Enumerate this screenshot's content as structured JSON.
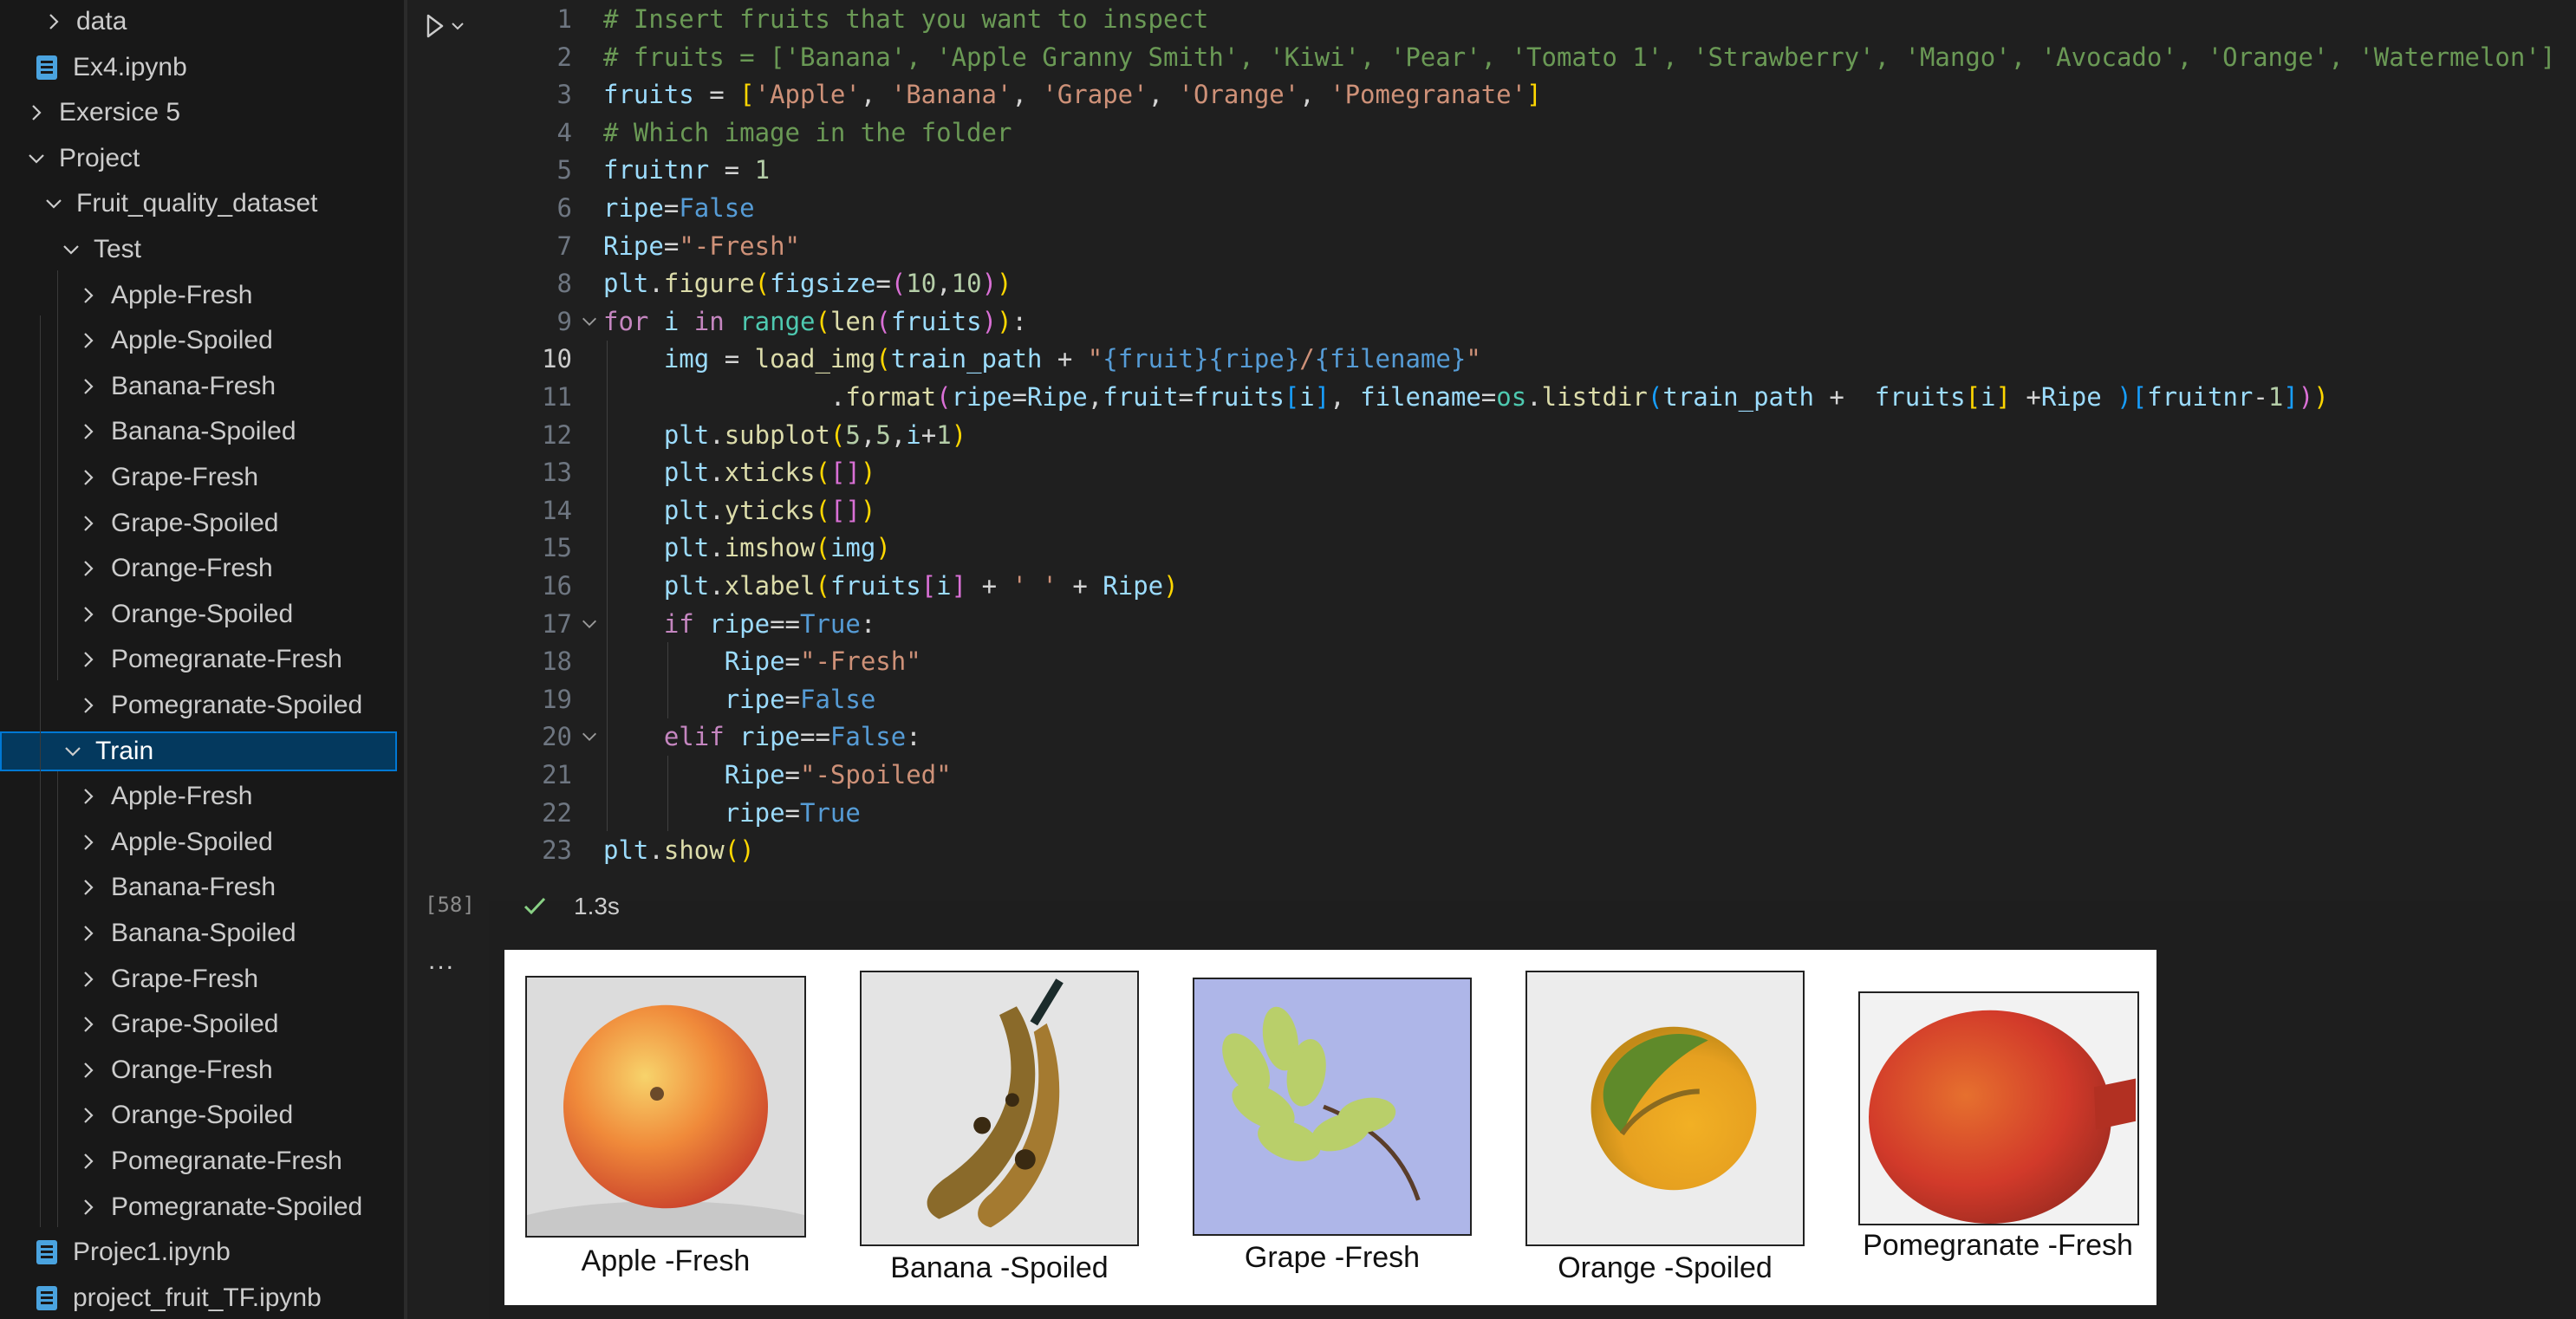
{
  "explorer": {
    "items": [
      {
        "label": "data",
        "depth": 1,
        "kind": "folder",
        "expanded": false
      },
      {
        "label": "Ex4.ipynb",
        "depth": 1,
        "kind": "notebook"
      },
      {
        "label": "Exersice 5",
        "depth": 0,
        "kind": "folder",
        "expanded": false
      },
      {
        "label": "Project",
        "depth": 0,
        "kind": "folder",
        "expanded": true
      },
      {
        "label": "Fruit_quality_dataset",
        "depth": 1,
        "kind": "folder",
        "expanded": true
      },
      {
        "label": "Test",
        "depth": 2,
        "kind": "folder",
        "expanded": true
      },
      {
        "label": "Apple-Fresh",
        "depth": 3,
        "kind": "folder",
        "expanded": false
      },
      {
        "label": "Apple-Spoiled",
        "depth": 3,
        "kind": "folder",
        "expanded": false
      },
      {
        "label": "Banana-Fresh",
        "depth": 3,
        "kind": "folder",
        "expanded": false
      },
      {
        "label": "Banana-Spoiled",
        "depth": 3,
        "kind": "folder",
        "expanded": false
      },
      {
        "label": "Grape-Fresh",
        "depth": 3,
        "kind": "folder",
        "expanded": false
      },
      {
        "label": "Grape-Spoiled",
        "depth": 3,
        "kind": "folder",
        "expanded": false
      },
      {
        "label": "Orange-Fresh",
        "depth": 3,
        "kind": "folder",
        "expanded": false
      },
      {
        "label": "Orange-Spoiled",
        "depth": 3,
        "kind": "folder",
        "expanded": false
      },
      {
        "label": "Pomegranate-Fresh",
        "depth": 3,
        "kind": "folder",
        "expanded": false
      },
      {
        "label": "Pomegranate-Spoiled",
        "depth": 3,
        "kind": "folder",
        "expanded": false
      },
      {
        "label": "Train",
        "depth": 2,
        "kind": "folder",
        "expanded": true,
        "selected": true
      },
      {
        "label": "Apple-Fresh",
        "depth": 3,
        "kind": "folder",
        "expanded": false
      },
      {
        "label": "Apple-Spoiled",
        "depth": 3,
        "kind": "folder",
        "expanded": false
      },
      {
        "label": "Banana-Fresh",
        "depth": 3,
        "kind": "folder",
        "expanded": false
      },
      {
        "label": "Banana-Spoiled",
        "depth": 3,
        "kind": "folder",
        "expanded": false
      },
      {
        "label": "Grape-Fresh",
        "depth": 3,
        "kind": "folder",
        "expanded": false
      },
      {
        "label": "Grape-Spoiled",
        "depth": 3,
        "kind": "folder",
        "expanded": false
      },
      {
        "label": "Orange-Fresh",
        "depth": 3,
        "kind": "folder",
        "expanded": false
      },
      {
        "label": "Orange-Spoiled",
        "depth": 3,
        "kind": "folder",
        "expanded": false
      },
      {
        "label": "Pomegranate-Fresh",
        "depth": 3,
        "kind": "folder",
        "expanded": false
      },
      {
        "label": "Pomegranate-Spoiled",
        "depth": 3,
        "kind": "folder",
        "expanded": false
      },
      {
        "label": "Projec1.ipynb",
        "depth": 1,
        "kind": "notebook"
      },
      {
        "label": "project_fruit_TF.ipynb",
        "depth": 1,
        "kind": "notebook"
      }
    ]
  },
  "cell": {
    "execution_count": "[58]",
    "status_time": "1.3s",
    "output_indicator": "...",
    "active_line": 10,
    "fold_lines": [
      9,
      17,
      20
    ],
    "lines": [
      [
        [
          "c-com",
          "# Insert fruits that you want to inspect"
        ]
      ],
      [
        [
          "c-com",
          "# fruits = ['Banana', 'Apple Granny Smith', 'Kiwi', 'Pear', 'Tomato 1', 'Strawberry', 'Mango', 'Avocado', 'Orange', 'Watermelon']"
        ]
      ],
      [
        [
          "c-var",
          "fruits"
        ],
        [
          "c-op",
          " = "
        ],
        [
          "c-b1",
          "["
        ],
        [
          "c-str",
          "'Apple'"
        ],
        [
          "c-op",
          ", "
        ],
        [
          "c-str",
          "'Banana'"
        ],
        [
          "c-op",
          ", "
        ],
        [
          "c-str",
          "'Grape'"
        ],
        [
          "c-op",
          ", "
        ],
        [
          "c-str",
          "'Orange'"
        ],
        [
          "c-op",
          ", "
        ],
        [
          "c-str",
          "'Pomegranate'"
        ],
        [
          "c-b1",
          "]"
        ]
      ],
      [
        [
          "c-com",
          "# Which image in the folder"
        ]
      ],
      [
        [
          "c-var",
          "fruitnr"
        ],
        [
          "c-op",
          " = "
        ],
        [
          "c-num",
          "1"
        ]
      ],
      [
        [
          "c-var",
          "ripe"
        ],
        [
          "c-op",
          "="
        ],
        [
          "c-const",
          "False"
        ]
      ],
      [
        [
          "c-var",
          "Ripe"
        ],
        [
          "c-op",
          "="
        ],
        [
          "c-str",
          "\"-Fresh\""
        ]
      ],
      [
        [
          "c-var",
          "plt"
        ],
        [
          "c-op",
          "."
        ],
        [
          "c-fn",
          "figure"
        ],
        [
          "c-b1",
          "("
        ],
        [
          "c-var",
          "figsize"
        ],
        [
          "c-op",
          "="
        ],
        [
          "c-b2",
          "("
        ],
        [
          "c-num",
          "10"
        ],
        [
          "c-op",
          ","
        ],
        [
          "c-num",
          "10"
        ],
        [
          "c-b2",
          ")"
        ],
        [
          "c-b1",
          ")"
        ]
      ],
      [
        [
          "c-kw",
          "for"
        ],
        [
          "c-op",
          " "
        ],
        [
          "c-var",
          "i"
        ],
        [
          "c-op",
          " "
        ],
        [
          "c-kw",
          "in"
        ],
        [
          "c-op",
          " "
        ],
        [
          "c-cls",
          "range"
        ],
        [
          "c-b1",
          "("
        ],
        [
          "c-fn",
          "len"
        ],
        [
          "c-b2",
          "("
        ],
        [
          "c-var",
          "fruits"
        ],
        [
          "c-b2",
          ")"
        ],
        [
          "c-b1",
          ")"
        ],
        [
          "c-op",
          ":"
        ]
      ],
      [
        [
          "c-op",
          "    "
        ],
        [
          "c-var",
          "img"
        ],
        [
          "c-op",
          " = "
        ],
        [
          "c-fn",
          "load_img"
        ],
        [
          "c-b1",
          "("
        ],
        [
          "c-var",
          "train_path"
        ],
        [
          "c-op",
          " + "
        ],
        [
          "c-str",
          "\""
        ],
        [
          "c-const",
          "{fruit}{ripe}"
        ],
        [
          "c-str",
          "/"
        ],
        [
          "c-const",
          "{filename}"
        ],
        [
          "c-str",
          "\""
        ]
      ],
      [
        [
          "c-op",
          "               "
        ],
        [
          "c-op",
          "."
        ],
        [
          "c-fn",
          "format"
        ],
        [
          "c-b2",
          "("
        ],
        [
          "c-var",
          "ripe"
        ],
        [
          "c-op",
          "="
        ],
        [
          "c-var",
          "Ripe"
        ],
        [
          "c-op",
          ","
        ],
        [
          "c-var",
          "fruit"
        ],
        [
          "c-op",
          "="
        ],
        [
          "c-var",
          "fruits"
        ],
        [
          "c-b3",
          "["
        ],
        [
          "c-var",
          "i"
        ],
        [
          "c-b3",
          "]"
        ],
        [
          "c-op",
          ", "
        ],
        [
          "c-var",
          "filename"
        ],
        [
          "c-op",
          "="
        ],
        [
          "c-cls",
          "os"
        ],
        [
          "c-op",
          "."
        ],
        [
          "c-fn",
          "listdir"
        ],
        [
          "c-b3",
          "("
        ],
        [
          "c-var",
          "train_path"
        ],
        [
          "c-op",
          " +  "
        ],
        [
          "c-var",
          "fruits"
        ],
        [
          "c-b1",
          "["
        ],
        [
          "c-var",
          "i"
        ],
        [
          "c-b1",
          "]"
        ],
        [
          "c-op",
          " +"
        ],
        [
          "c-var",
          "Ripe"
        ],
        [
          "c-op",
          " "
        ],
        [
          "c-b3",
          ")"
        ],
        [
          "c-b3",
          "["
        ],
        [
          "c-var",
          "fruitnr"
        ],
        [
          "c-op",
          "-"
        ],
        [
          "c-num",
          "1"
        ],
        [
          "c-b3",
          "]"
        ],
        [
          "c-b2",
          ")"
        ],
        [
          "c-b1",
          ")"
        ]
      ],
      [
        [
          "c-op",
          "    "
        ],
        [
          "c-var",
          "plt"
        ],
        [
          "c-op",
          "."
        ],
        [
          "c-fn",
          "subplot"
        ],
        [
          "c-b1",
          "("
        ],
        [
          "c-num",
          "5"
        ],
        [
          "c-op",
          ","
        ],
        [
          "c-num",
          "5"
        ],
        [
          "c-op",
          ","
        ],
        [
          "c-var",
          "i"
        ],
        [
          "c-op",
          "+"
        ],
        [
          "c-num",
          "1"
        ],
        [
          "c-b1",
          ")"
        ]
      ],
      [
        [
          "c-op",
          "    "
        ],
        [
          "c-var",
          "plt"
        ],
        [
          "c-op",
          "."
        ],
        [
          "c-fn",
          "xticks"
        ],
        [
          "c-b1",
          "("
        ],
        [
          "c-b2",
          "[]"
        ],
        [
          "c-b1",
          ")"
        ]
      ],
      [
        [
          "c-op",
          "    "
        ],
        [
          "c-var",
          "plt"
        ],
        [
          "c-op",
          "."
        ],
        [
          "c-fn",
          "yticks"
        ],
        [
          "c-b1",
          "("
        ],
        [
          "c-b2",
          "[]"
        ],
        [
          "c-b1",
          ")"
        ]
      ],
      [
        [
          "c-op",
          "    "
        ],
        [
          "c-var",
          "plt"
        ],
        [
          "c-op",
          "."
        ],
        [
          "c-fn",
          "imshow"
        ],
        [
          "c-b1",
          "("
        ],
        [
          "c-var",
          "img"
        ],
        [
          "c-b1",
          ")"
        ]
      ],
      [
        [
          "c-op",
          "    "
        ],
        [
          "c-var",
          "plt"
        ],
        [
          "c-op",
          "."
        ],
        [
          "c-fn",
          "xlabel"
        ],
        [
          "c-b1",
          "("
        ],
        [
          "c-var",
          "fruits"
        ],
        [
          "c-b2",
          "["
        ],
        [
          "c-var",
          "i"
        ],
        [
          "c-b2",
          "]"
        ],
        [
          "c-op",
          " + "
        ],
        [
          "c-str",
          "' '"
        ],
        [
          "c-op",
          " + "
        ],
        [
          "c-var",
          "Ripe"
        ],
        [
          "c-b1",
          ")"
        ]
      ],
      [
        [
          "c-op",
          "    "
        ],
        [
          "c-kw",
          "if"
        ],
        [
          "c-op",
          " "
        ],
        [
          "c-var",
          "ripe"
        ],
        [
          "c-op",
          "=="
        ],
        [
          "c-const",
          "True"
        ],
        [
          "c-op",
          ":"
        ]
      ],
      [
        [
          "c-op",
          "        "
        ],
        [
          "c-var",
          "Ripe"
        ],
        [
          "c-op",
          "="
        ],
        [
          "c-str",
          "\"-Fresh\""
        ]
      ],
      [
        [
          "c-op",
          "        "
        ],
        [
          "c-var",
          "ripe"
        ],
        [
          "c-op",
          "="
        ],
        [
          "c-const",
          "False"
        ]
      ],
      [
        [
          "c-op",
          "    "
        ],
        [
          "c-kw",
          "elif"
        ],
        [
          "c-op",
          " "
        ],
        [
          "c-var",
          "ripe"
        ],
        [
          "c-op",
          "=="
        ],
        [
          "c-const",
          "False"
        ],
        [
          "c-op",
          ":"
        ]
      ],
      [
        [
          "c-op",
          "        "
        ],
        [
          "c-var",
          "Ripe"
        ],
        [
          "c-op",
          "="
        ],
        [
          "c-str",
          "\"-Spoiled\""
        ]
      ],
      [
        [
          "c-op",
          "        "
        ],
        [
          "c-var",
          "ripe"
        ],
        [
          "c-op",
          "="
        ],
        [
          "c-const",
          "True"
        ]
      ],
      [
        [
          "c-var",
          "plt"
        ],
        [
          "c-op",
          "."
        ],
        [
          "c-fn",
          "show"
        ],
        [
          "c-b1",
          "("
        ],
        [
          "c-b1",
          ")"
        ]
      ]
    ]
  },
  "output_figure": {
    "subplots": [
      {
        "label": "Apple -Fresh",
        "image": "apple"
      },
      {
        "label": "Banana -Spoiled",
        "image": "banana"
      },
      {
        "label": "Grape -Fresh",
        "image": "grape"
      },
      {
        "label": "Orange -Spoiled",
        "image": "orange"
      },
      {
        "label": "Pomegranate -Fresh",
        "image": "pomegranate"
      }
    ]
  },
  "colors": {
    "selection_bg": "#04395e",
    "selection_border": "#0078d4",
    "success_check": "#89d185",
    "notebook_icon": "#4aa3df"
  }
}
